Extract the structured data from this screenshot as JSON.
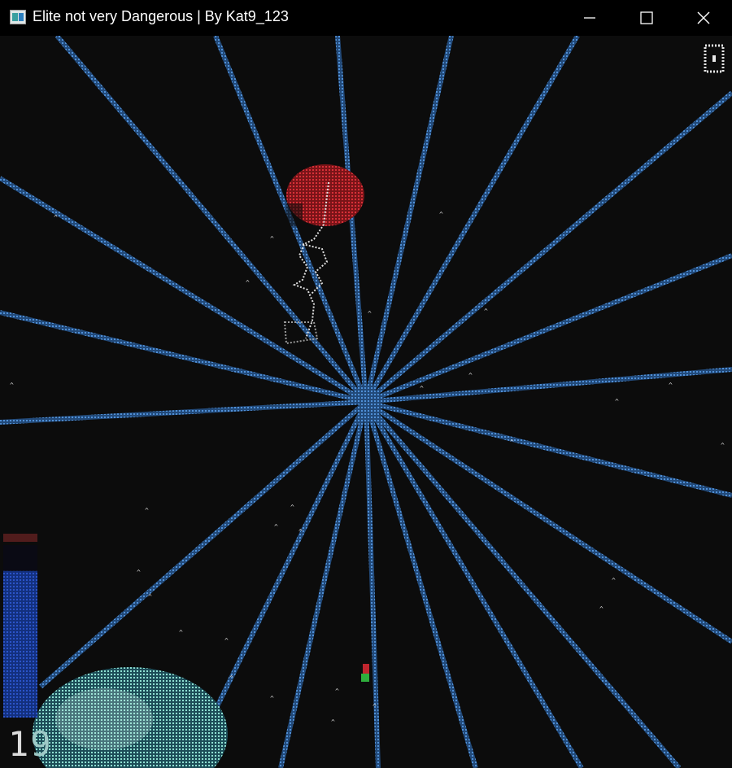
{
  "window": {
    "title": "Elite not very Dangerous | By Kat9_123",
    "minimize_icon": "minimize-icon",
    "maximize_icon": "maximize-icon",
    "close_icon": "close-icon"
  },
  "hud": {
    "score": "1",
    "score_rest": "9",
    "pause_icon": "pause-indicator-icon",
    "fuel_gauge_level": 0.85
  },
  "colors": {
    "background": "#0c0c0c",
    "warp_lines": "#3f7fc8",
    "gauge": "#1e44b4",
    "planet_red": "#c0252e",
    "planet_teal": "#7fd0c2",
    "ship": "#e6e6e6"
  }
}
